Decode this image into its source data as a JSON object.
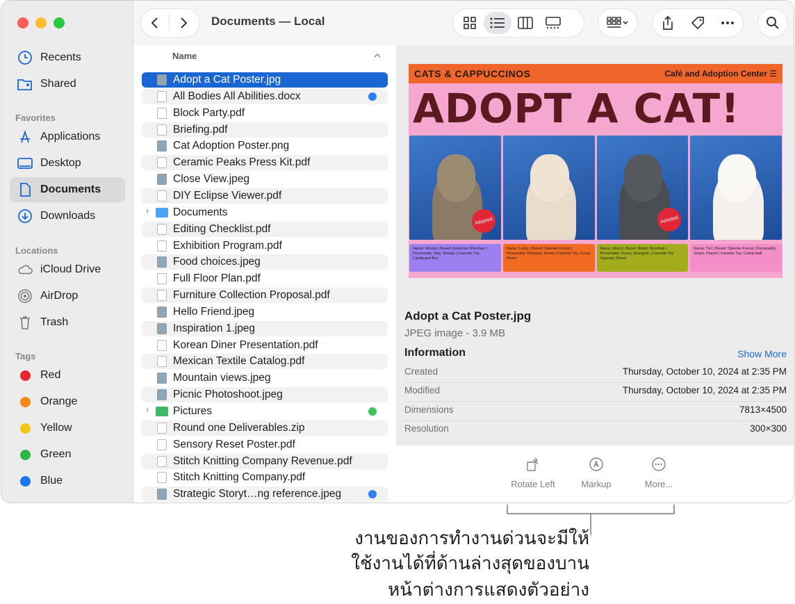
{
  "sidebar": {
    "recents": "Recents",
    "shared": "Shared",
    "favorites_header": "Favorites",
    "applications": "Applications",
    "desktop": "Desktop",
    "documents": "Documents",
    "downloads": "Downloads",
    "locations_header": "Locations",
    "icloud": "iCloud Drive",
    "airdrop": "AirDrop",
    "trash": "Trash",
    "tags_header": "Tags",
    "tags": [
      {
        "label": "Red",
        "color": "#e5272f"
      },
      {
        "label": "Orange",
        "color": "#f2891a"
      },
      {
        "label": "Yellow",
        "color": "#f5c518"
      },
      {
        "label": "Green",
        "color": "#2db744"
      },
      {
        "label": "Blue",
        "color": "#1a75e8"
      }
    ]
  },
  "toolbar": {
    "title": "Documents — Local"
  },
  "list": {
    "header": "Name",
    "files": [
      "Adopt a Cat Poster.jpg",
      "All Bodies All Abilities.docx",
      "Block Party.pdf",
      "Briefing.pdf",
      "Cat Adoption Poster.png",
      "Ceramic Peaks Press Kit.pdf",
      "Close View.jpeg",
      "DIY Eclipse Viewer.pdf",
      "Documents",
      "Editing Checklist.pdf",
      "Exhibition Program.pdf",
      "Food choices.jpeg",
      "Full Floor Plan.pdf",
      "Furniture Collection Proposal.pdf",
      "Hello Friend.jpeg",
      "Inspiration 1.jpeg",
      "Korean Diner Presentation.pdf",
      "Mexican Textile Catalog.pdf",
      "Mountain views.jpeg",
      "Picnic Photoshoot.jpeg",
      "Pictures",
      "Round one Deliverables.zip",
      "Sensory Reset Poster.pdf",
      "Stitch Knitting Company Revenue.pdf",
      "Stitch Knitting Company.pdf",
      "Strategic Storyt…ng reference.jpeg"
    ]
  },
  "poster": {
    "brand": "CATS & CAPPUCCINOS",
    "subtitle": "Café and Adoption Center",
    "headline": "ADOPT A CAT!",
    "stamp": "Adopted",
    "cards": [
      "Name: Woody | Breed: American Shorthair | Personality: Silly, Sneaky | Favorite Toy: Cardboard Box",
      "Name: Lucky | Breed: Siberian Forest | Personality: Relaxed, Sweet | Favorite Toy: Fuzzy Worm",
      "Name: Mozzi | Breed: British Shorthair | Personality: Funny, Energetic | Favorite Toy: Squeaky Donut",
      "Name: Tori | Breed: Siberian Forest | Personality: Smart, Playful | Favorite Toy: Catnip Ball"
    ]
  },
  "info": {
    "file_name": "Adopt a Cat Poster.jpg",
    "kind": "JPEG image - 3.9 MB",
    "section": "Information",
    "show_more": "Show More",
    "created_label": "Created",
    "created_value": "Thursday, October 10, 2024 at 2:35 PM",
    "modified_label": "Modified",
    "modified_value": "Thursday, October 10, 2024 at 2:35 PM",
    "dimensions_label": "Dimensions",
    "dimensions_value": "7813×4500",
    "resolution_label": "Resolution",
    "resolution_value": "300×300"
  },
  "actions": {
    "rotate": "Rotate Left",
    "markup": "Markup",
    "more": "More..."
  },
  "callout": {
    "line1": "งานของการทำงานด่วนจะมีให้",
    "line2": "ใช้งานได้ที่ด้านล่างสุดของบาน",
    "line3": "หน้าต่างการแสดงตัวอย่าง"
  }
}
